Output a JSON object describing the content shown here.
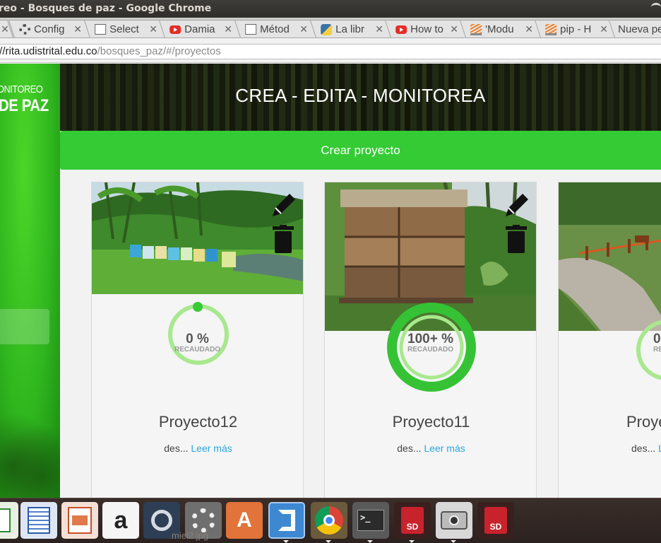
{
  "window": {
    "title": "reo - Bosques de paz - Google Chrome"
  },
  "tabs": [
    {
      "label": "",
      "icon": "none"
    },
    {
      "label": "Config",
      "icon": "gear-icon"
    },
    {
      "label": "Select",
      "icon": "document-icon"
    },
    {
      "label": "Damia",
      "icon": "youtube-icon"
    },
    {
      "label": "Métod",
      "icon": "document-icon"
    },
    {
      "label": "La libr",
      "icon": "python-icon"
    },
    {
      "label": "How to",
      "icon": "youtube-icon"
    },
    {
      "label": "'Modu",
      "icon": "stackoverflow-icon"
    },
    {
      "label": "pip - H",
      "icon": "stackoverflow-icon"
    },
    {
      "label": "Nueva pe",
      "icon": "none"
    }
  ],
  "address": {
    "host": "://rita.udistrital.edu.co",
    "path": "/bosques_paz/#/proyectos"
  },
  "sidebar": {
    "brand_line1": "ONITOREO",
    "brand_line2": "DE PAZ"
  },
  "hero": {
    "title": "CREA - EDITA - MONITOREA"
  },
  "create": {
    "label": "Crear proyecto"
  },
  "cards": [
    {
      "name": "Proyecto12",
      "percent": "0 %",
      "percent_value": 0,
      "raised_label": "RECAUDADO",
      "desc": "des...",
      "more": "Leer más"
    },
    {
      "name": "Proyecto11",
      "percent": "100+ %",
      "percent_value": 100,
      "raised_label": "RECAUDADO",
      "desc": "des...",
      "more": "Leer más"
    },
    {
      "name": "Proye",
      "percent": "0",
      "percent_value": 0,
      "raised_label": "RECA",
      "desc": "des...",
      "more": "L"
    }
  ],
  "taskbar": {
    "tooltip": "miel2.jpg",
    "apps": [
      "spreadsheet-icon",
      "writer-icon",
      "impress-icon",
      "amazon-icon",
      "steam-icon",
      "settings-icon",
      "software-center-icon",
      "vscode-icon",
      "chrome-icon",
      "terminal-icon",
      "sd-card-icon",
      "camera-icon",
      "sd-card-icon"
    ]
  },
  "colors": {
    "accent": "#35cb35",
    "ring_light": "#a8e88f",
    "ring_full": "#35c335",
    "link": "#2aa6dc"
  }
}
